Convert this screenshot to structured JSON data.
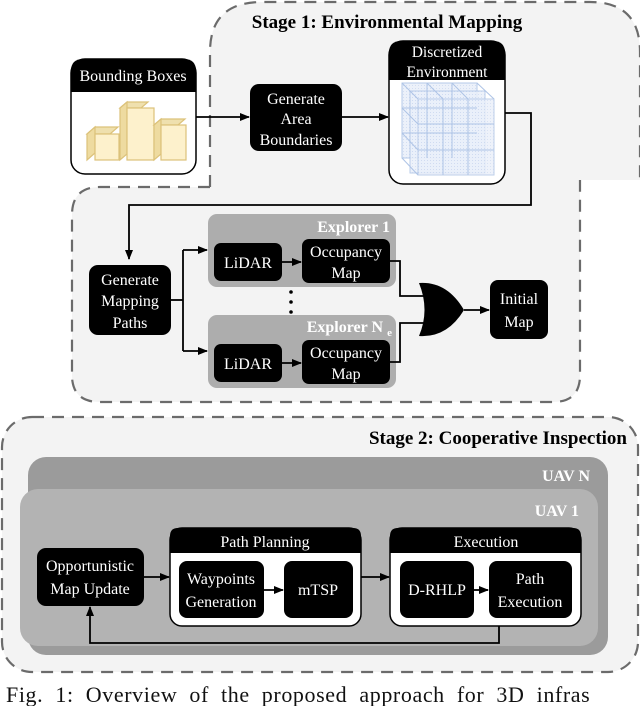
{
  "stage1": {
    "title": "Stage 1: Environmental Mapping",
    "bounding_boxes": {
      "label": "Bounding Boxes",
      "icon": "buildings-icon"
    },
    "generate_area": {
      "lines": [
        "Generate",
        "Area",
        "Boundaries"
      ]
    },
    "discretized": {
      "lines": [
        "Discretized",
        "Environment"
      ],
      "icon": "voxel-grid-icon"
    },
    "generate_mapping": {
      "lines": [
        "Generate",
        "Mapping",
        "Paths"
      ]
    },
    "explorer_first": {
      "title": "Explorer 1",
      "lidar": "LiDAR",
      "occupancy": [
        "Occupancy",
        "Map"
      ]
    },
    "explorer_last": {
      "title": "Explorer N",
      "title_subscript": "e",
      "lidar": "LiDAR",
      "occupancy": [
        "Occupancy",
        "Map"
      ]
    },
    "merge_gate": "or-gate-icon",
    "initial_map": {
      "lines": [
        "Initial",
        "Map"
      ]
    }
  },
  "stage2": {
    "title": "Stage 2: Cooperative Inspection",
    "uav_back": "UAV N",
    "uav_front": "UAV 1",
    "opportunistic": {
      "lines": [
        "Opportunistic",
        "Map Update"
      ]
    },
    "path_planning": {
      "title": "Path Planning",
      "waypoints": [
        "Waypoints",
        "Generation"
      ],
      "mtsp": "mTSP"
    },
    "execution": {
      "title": "Execution",
      "drhlp": "D-RHLP",
      "path_exec": [
        "Path",
        "Execution"
      ]
    }
  },
  "colors": {
    "stage_bg": "#f3f3f3",
    "dash": "#6b6b6b",
    "explorer_bg": "#adadad",
    "uav_back_bg": "#9b9b9b",
    "uav_front_bg": "#b3b3b3",
    "building_fill": "#fdf1cc",
    "building_stroke": "#dcc27a",
    "voxel": "#aec4e6"
  },
  "caption": "Fig. 1: Overview of the proposed approach for 3D infras"
}
